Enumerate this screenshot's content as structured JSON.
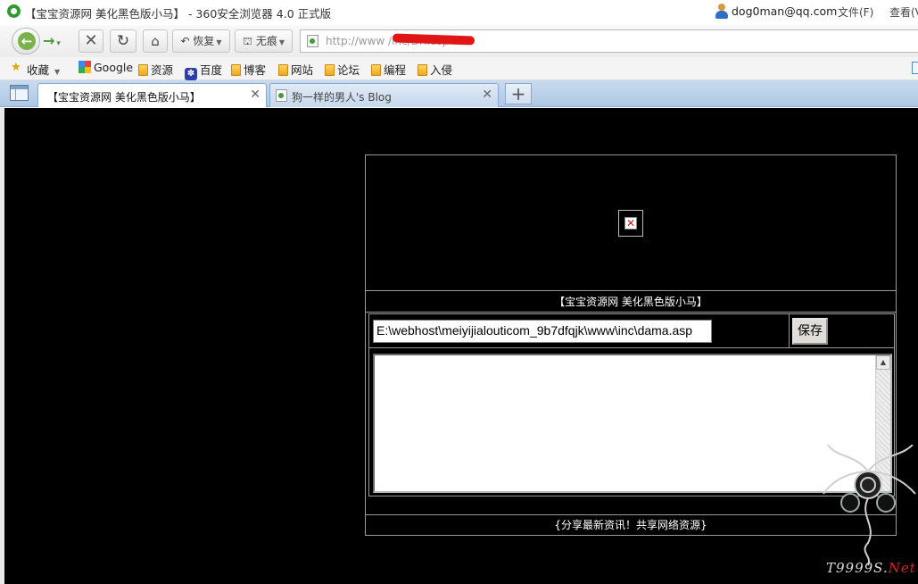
{
  "window": {
    "title": "【宝宝资源网 美化黑色版小马】 - 360安全浏览器 4.0 正式版",
    "user_email": "dog0man@qq.com",
    "menu_file": "文件(F)",
    "menu_view": "查看(V"
  },
  "toolbar": {
    "restore_label": "恢复",
    "incognito_label": "无痕",
    "address_url": "http://www                    /inc/DIY.asp"
  },
  "bookmarks": {
    "favorites_label": "收藏",
    "items": [
      {
        "label": "Google",
        "icon": "google-icon"
      },
      {
        "label": "资源",
        "icon": "folder-icon"
      },
      {
        "label": "百度",
        "icon": "paw-icon"
      },
      {
        "label": "博客",
        "icon": "folder-icon"
      },
      {
        "label": "网站",
        "icon": "folder-icon"
      },
      {
        "label": "论坛",
        "icon": "folder-icon"
      },
      {
        "label": "编程",
        "icon": "folder-icon"
      },
      {
        "label": "入侵",
        "icon": "folder-icon"
      }
    ]
  },
  "tabs": [
    {
      "label": "【宝宝资源网 美化黑色版小马】",
      "active": true
    },
    {
      "label": "狗一样的男人's Blog",
      "active": false
    }
  ],
  "page": {
    "header_title": "【宝宝资源网 美化黑色版小马】",
    "file_path_value": "E:\\webhost\\meiyijialouticom_9b7dfqjk\\www\\inc\\dama.asp",
    "save_label": "保存",
    "editor_content": "",
    "footer_text": "{分享最新资讯！共享网络资源}"
  },
  "watermark": {
    "text_main": "T9999S.",
    "text_net": "Net"
  },
  "colors": {
    "page_background": "#000000",
    "accent_green": "#79b14a",
    "tab_strip": "#b8d0ea",
    "watermark_red": "#d8242a"
  }
}
